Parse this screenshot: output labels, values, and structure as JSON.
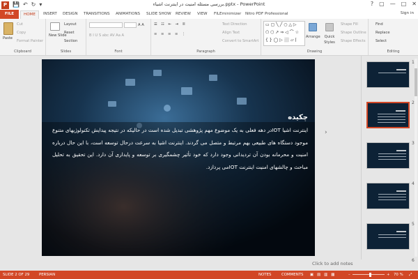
{
  "window": {
    "title": "بررسی مسئله امنیت در اینترنت اشیاء.pptx - PowerPoint",
    "controls": [
      "?",
      "▢",
      "—",
      "□",
      "✕"
    ]
  },
  "qat": {
    "app_icon": "P",
    "save": "💾",
    "undo": "↶",
    "redo": "↻",
    "customize": "▾"
  },
  "tabs": [
    "FILE",
    "HOME",
    "INSERT",
    "DESIGN",
    "TRANSITIONS",
    "ANIMATIONS",
    "SLIDE SHOW",
    "REVIEW",
    "VIEW",
    "FILEminimizer",
    "Nitro PDF Professional"
  ],
  "active_tab": "HOME",
  "signin": "Sign in",
  "ribbon": {
    "clipboard": {
      "paste": "Paste",
      "cut": "Cut",
      "copy": "Copy",
      "format_painter": "Format Painter",
      "label": "Clipboard"
    },
    "slides": {
      "new_slide": "New Slide",
      "layout": "Layout",
      "reset": "Reset",
      "section": "Section",
      "label": "Slides"
    },
    "font": {
      "label": "Font",
      "buttons": "B  I  U  S  abc  AV  Aa  A"
    },
    "paragraph": {
      "text_direction": "Text Direction",
      "align_text": "Align Text",
      "convert_smartart": "Convert to SmartArt",
      "label": "Paragraph"
    },
    "drawing": {
      "arrange": "Arrange",
      "quick_styles": "Quick Styles",
      "shape_fill": "Shape Fill",
      "shape_outline": "Shape Outline",
      "shape_effects": "Shape Effects",
      "label": "Drawing"
    },
    "editing": {
      "find": "Find",
      "replace": "Replace",
      "select": "Select",
      "label": "Editing"
    }
  },
  "slide": {
    "heading": "چکیده",
    "body": "اینترنت اشیا IOTدر دهه فعلی به یک موضوع مهم پژوهشی تبدیل شده است در حالیکه در نتیجه پیدایش تکنولوژیهای متنوع موجود دستگاه های طبیعی بهم مرتبط و متصل می گردند. اینترنت اشیا به سرعت درحال توسعه است، با این حال درباره امنیت و محرمانه بودن آن تردیدانی وجود دارد که خود تأثیر چشمگیری بر توسعه و پایداری آن دارد. این تحقیق به تحلیل مباحث و چالشهای امنیت اینترنت IOTمی پردازد."
  },
  "thumbnails": [
    {
      "number": "1",
      "selected": false
    },
    {
      "number": "2",
      "selected": true
    },
    {
      "number": "3",
      "selected": false
    },
    {
      "number": "4",
      "selected": false
    },
    {
      "number": "5",
      "selected": false
    },
    {
      "number": "6",
      "selected": false
    }
  ],
  "notes_placeholder": "Click to add notes",
  "status": {
    "slide_counter": "SLIDE 2 OF 29",
    "language": "PERSIAN",
    "notes": "NOTES",
    "comments": "COMMENTS",
    "zoom": "70 %"
  },
  "colors": {
    "accent": "#d24726",
    "ribbon_bg": "#f3f3f3",
    "workspace_bg": "#e6e6e6"
  }
}
